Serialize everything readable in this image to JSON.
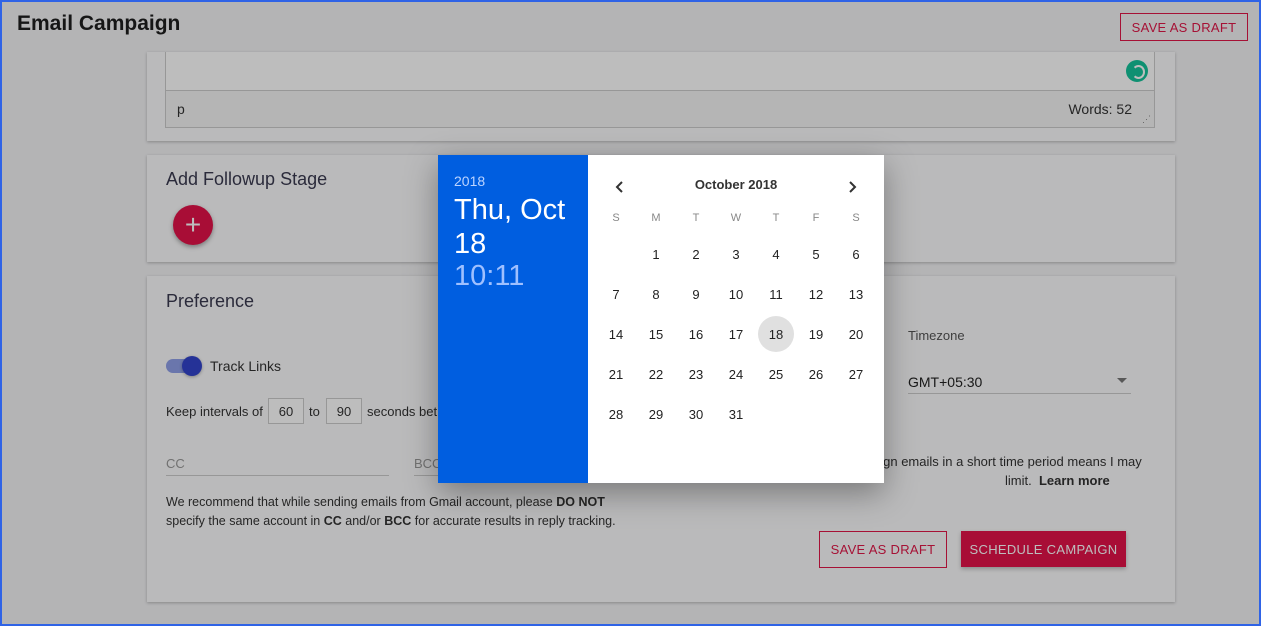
{
  "header": {
    "title": "Email Campaign",
    "save_draft_label": "SAVE AS DRAFT"
  },
  "editor": {
    "path_text": "p",
    "word_count": "Words: 52"
  },
  "followup": {
    "title": "Add Followup Stage",
    "add_label": "+"
  },
  "preference": {
    "title": "Preference",
    "track_links_label": "Track Links",
    "track_links_on": true,
    "interval_prefix": "Keep intervals of",
    "interval_min": "60",
    "interval_to": "to",
    "interval_max": "90",
    "interval_suffix": "seconds bet",
    "cc_placeholder": "CC",
    "bcc_placeholder": "BCC",
    "note_1": "We recommend that while sending emails from Gmail account, please",
    "note_1_bold": "DO NOT",
    "note_2": "specify the same account in",
    "note_2_cc": "CC",
    "note_2_and": "and/or",
    "note_2_bcc": "BCC",
    "note_2_end": "for accurate results in reply tracking.",
    "timezone_label": "Timezone",
    "timezone_value": "GMT+05:30",
    "warning_line1": "aign emails in a short time period means I may",
    "warning_line2": "limit.",
    "learn_more": "Learn more",
    "save_draft_label": "SAVE AS DRAFT",
    "schedule_label": "SCHEDULE CAMPAIGN"
  },
  "datepicker": {
    "year": "2018",
    "date_label": "Thu, Oct 18",
    "time": "10:11",
    "month_label": "October 2018",
    "weekdays": [
      "S",
      "M",
      "T",
      "W",
      "T",
      "F",
      "S"
    ],
    "start_offset": 1,
    "days_in_month": 31,
    "selected_day": 18
  },
  "colors": {
    "accent": "#e3124a",
    "picker_header": "#005ee0",
    "toggle": "#3344cc",
    "grammarly": "#15c39a"
  }
}
